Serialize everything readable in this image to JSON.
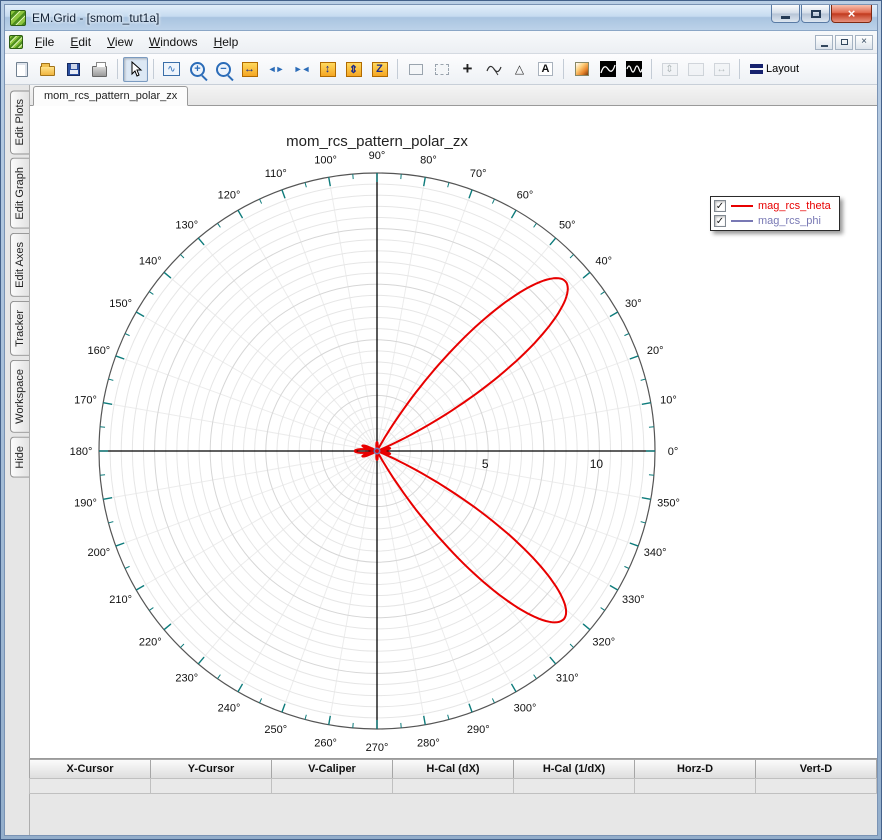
{
  "window": {
    "title": "EM.Grid - [smom_tut1a]"
  },
  "menu": {
    "items": [
      "File",
      "Edit",
      "View",
      "Windows",
      "Help"
    ]
  },
  "toolbar": {
    "items": [
      {
        "name": "new-document-button",
        "glyph": "page"
      },
      {
        "name": "open-button",
        "glyph": "folder"
      },
      {
        "name": "save-button",
        "glyph": "floppy"
      },
      {
        "name": "print-button",
        "glyph": "printer"
      },
      {
        "sep": true
      },
      {
        "name": "select-tool-button",
        "glyph": "cursor",
        "pressed": true
      },
      {
        "sep": true
      },
      {
        "name": "zoom-region-button",
        "glyph": "zoombox"
      },
      {
        "name": "zoom-in-button",
        "glyph": "zoomin"
      },
      {
        "name": "zoom-out-button",
        "glyph": "zoomout"
      },
      {
        "name": "expand-horizontal-button",
        "glyph": "harrows"
      },
      {
        "name": "pan-horizontal-button",
        "glyph": "lrtri"
      },
      {
        "name": "collapse-horizontal-button",
        "glyph": "rltri"
      },
      {
        "name": "expand-vertical-button",
        "glyph": "varrows"
      },
      {
        "name": "pan-vertical-button",
        "glyph": "udtri"
      },
      {
        "name": "autoscale-button",
        "glyph": "zed"
      },
      {
        "sep": true
      },
      {
        "name": "rect-select-tool-button",
        "glyph": "rect1"
      },
      {
        "name": "region-tool-button",
        "glyph": "rect2"
      },
      {
        "name": "crosshair-tool-button",
        "glyph": "plus"
      },
      {
        "name": "tracker-tool-button",
        "glyph": "tracker"
      },
      {
        "name": "marker-tool-button",
        "glyph": "triangle"
      },
      {
        "name": "text-tool-button",
        "glyph": "textA"
      },
      {
        "sep": true
      },
      {
        "name": "colormap-button",
        "glyph": "palette"
      },
      {
        "name": "waveform-1-button",
        "glyph": "wave1"
      },
      {
        "name": "waveform-2-button",
        "glyph": "wave2"
      },
      {
        "sep": true
      },
      {
        "name": "fit-vertical-button",
        "glyph": "fitv",
        "disabled": true
      },
      {
        "name": "fit-box-button",
        "glyph": "fitbox",
        "disabled": true
      },
      {
        "name": "fit-horizontal-button",
        "glyph": "fith",
        "disabled": true
      },
      {
        "sep": true
      },
      {
        "name": "layout-button",
        "glyph": "layout",
        "label": "Layout"
      }
    ]
  },
  "sidebar": {
    "tabs": [
      "Edit Plots",
      "Edit Graph",
      "Edit Axes",
      "Tracker",
      "Workspace",
      "Hide"
    ]
  },
  "tabstrip": {
    "tabs": [
      {
        "label": "mom_rcs_pattern_polar_zx",
        "active": true
      }
    ]
  },
  "chart_data": {
    "type": "polar",
    "title": "mom_rcs_pattern_polar_zx",
    "r_max": 12.5,
    "r_ticks": [
      5,
      10
    ],
    "grid_step": 0.5,
    "angle_step_deg": 10,
    "tick_color": "#0e7c7c",
    "series": [
      {
        "name": "mag_rcs_theta",
        "color": "#e80000",
        "width": 2,
        "base": 0,
        "lobes": [
          {
            "angle": 42,
            "amplitude": 11.4,
            "halfwidth": 20,
            "power": 1.5
          },
          {
            "angle": -42,
            "amplitude": 11.3,
            "halfwidth": 20,
            "power": 1.5
          },
          {
            "angle": 180,
            "amplitude": 1.0,
            "halfwidth": 14,
            "power": 1
          },
          {
            "angle": 160,
            "amplitude": 0.7,
            "halfwidth": 10,
            "power": 1
          },
          {
            "angle": 200,
            "amplitude": 0.7,
            "halfwidth": 10,
            "power": 1
          },
          {
            "angle": 12,
            "amplitude": 0.6,
            "halfwidth": 10,
            "power": 1
          },
          {
            "angle": -12,
            "amplitude": 0.6,
            "halfwidth": 10,
            "power": 1
          },
          {
            "angle": 90,
            "amplitude": 0.4,
            "halfwidth": 12,
            "power": 1
          },
          {
            "angle": -90,
            "amplitude": 0.4,
            "halfwidth": 12,
            "power": 1
          }
        ]
      },
      {
        "name": "mag_rcs_phi",
        "color": "#7878b4",
        "width": 1.5,
        "base": 0.12,
        "lobes": []
      }
    ],
    "legend": {
      "entries": [
        {
          "label": "mag_rcs_theta",
          "checked": true,
          "color": "#e80000"
        },
        {
          "label": "mag_rcs_phi",
          "checked": true,
          "color": "#7878b4"
        }
      ]
    }
  },
  "status_table": {
    "headers": [
      "X-Cursor",
      "Y-Cursor",
      "V-Caliper",
      "H-Cal (dX)",
      "H-Cal (1/dX)",
      "Horz-D",
      "Vert-D"
    ],
    "values": [
      "",
      "",
      "",
      "",
      "",
      "",
      ""
    ]
  }
}
